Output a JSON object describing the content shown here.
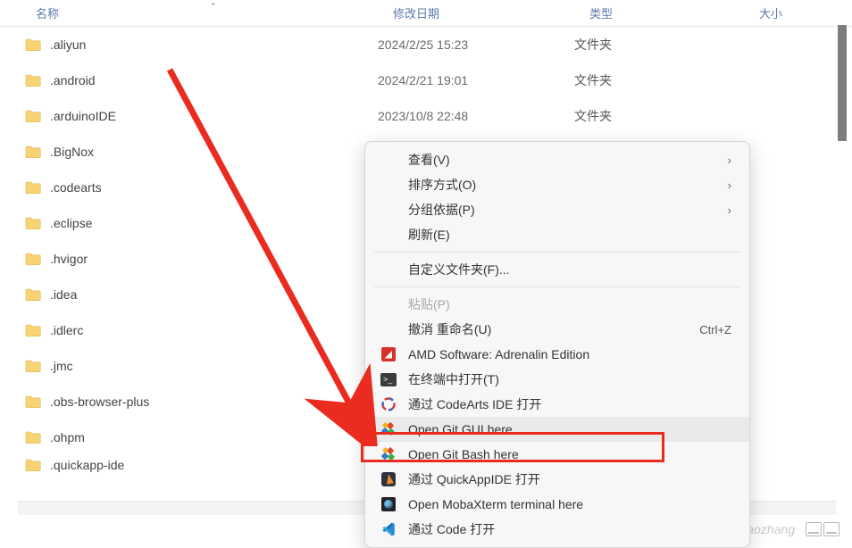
{
  "columns": {
    "name": "名称",
    "date": "修改日期",
    "type": "类型",
    "size": "大小"
  },
  "folder_type_label": "文件夹",
  "files": [
    {
      "name": ".aliyun",
      "date": "2024/2/25 15:23",
      "type": "文件夹"
    },
    {
      "name": ".android",
      "date": "2024/2/21 19:01",
      "type": "文件夹"
    },
    {
      "name": ".arduinoIDE",
      "date": "2023/10/8 22:48",
      "type": "文件夹"
    },
    {
      "name": ".BigNox",
      "date": "",
      "type": ""
    },
    {
      "name": ".codearts",
      "date": "",
      "type": ""
    },
    {
      "name": ".eclipse",
      "date": "",
      "type": ""
    },
    {
      "name": ".hvigor",
      "date": "",
      "type": ""
    },
    {
      "name": ".idea",
      "date": "",
      "type": ""
    },
    {
      "name": ".idlerc",
      "date": "",
      "type": ""
    },
    {
      "name": ".jmc",
      "date": "",
      "type": ""
    },
    {
      "name": ".obs-browser-plus",
      "date": "",
      "type": ""
    },
    {
      "name": ".ohpm",
      "date": "",
      "type": ""
    },
    {
      "name": ".quickapp-ide",
      "date": "",
      "type": ""
    }
  ],
  "context_menu": {
    "view": {
      "label": "查看(V)"
    },
    "sort": {
      "label": "排序方式(O)"
    },
    "group": {
      "label": "分组依据(P)"
    },
    "refresh": {
      "label": "刷新(E)"
    },
    "customize": {
      "label": "自定义文件夹(F)..."
    },
    "paste": {
      "label": "粘贴(P)"
    },
    "undo": {
      "label": "撤消 重命名(U)",
      "shortcut": "Ctrl+Z"
    },
    "amd": {
      "label": "AMD Software: Adrenalin Edition"
    },
    "terminal": {
      "label": "在终端中打开(T)"
    },
    "codearts": {
      "label": "通过 CodeArts IDE 打开"
    },
    "gitgui": {
      "label": "Open Git GUI here"
    },
    "gitbash": {
      "label": "Open Git Bash here"
    },
    "quickapp": {
      "label": "通过 QuickAppIDE 打开"
    },
    "moba": {
      "label": "Open MobaXterm terminal here"
    },
    "code": {
      "label": "通过 Code 打开"
    }
  },
  "watermark": "CSDN @louxiaozhang"
}
